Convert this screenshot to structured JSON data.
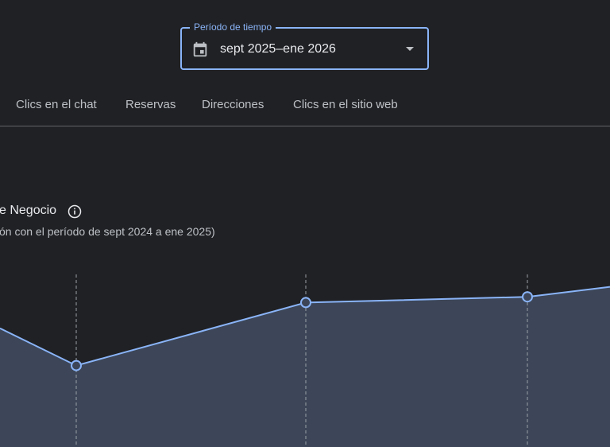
{
  "period": {
    "label": "Período de tiempo",
    "value": "sept 2025–ene 2026",
    "calendar_icon": "calendar-icon",
    "dropdown_icon": "caret-down-icon"
  },
  "tabs": [
    {
      "label": "Clics en el chat"
    },
    {
      "label": "Reservas"
    },
    {
      "label": "Direcciones"
    },
    {
      "label": "Clics en el sitio web"
    }
  ],
  "metric": {
    "title": "e Negocio",
    "info_icon": "info-icon",
    "subtitle": "ón con el período de sept 2024 a ene 2025)"
  },
  "colors": {
    "background": "#202124",
    "accent": "#8ab4f8",
    "area_fill": "#3c4658",
    "text_primary": "#e8eaed",
    "text_secondary": "#bdc1c6",
    "divider": "#5f6368"
  },
  "chart_data": {
    "type": "area",
    "points": [
      {
        "y": 0.77,
        "marker": false
      },
      {
        "y": 0.64,
        "marker": true,
        "guide": true
      },
      {
        "y": 0.86,
        "marker": true,
        "guide": true
      },
      {
        "y": 0.88,
        "marker": true,
        "guide": true
      },
      {
        "y": 0.915,
        "marker": false
      }
    ],
    "ylim": [
      0,
      1
    ],
    "grid": false
  }
}
